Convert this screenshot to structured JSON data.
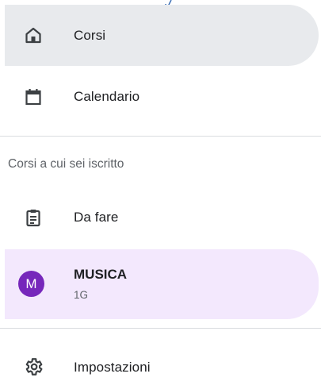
{
  "nav": {
    "items": [
      {
        "label": "Corsi",
        "icon": "home-icon",
        "state": "active"
      },
      {
        "label": "Calendario",
        "icon": "calendar-icon",
        "state": "normal"
      }
    ],
    "section_heading": "Corsi a cui sei iscritto",
    "todo": {
      "label": "Da fare",
      "icon": "clipboard-icon"
    },
    "course": {
      "avatar_letter": "M",
      "name": "MUSICA",
      "section": "1G",
      "avatar_color": "#7627bb",
      "highlight_color": "#f3e8fd"
    },
    "settings": {
      "label": "Impostazioni",
      "icon": "gear-icon"
    }
  },
  "colors": {
    "active_bg": "#e8eaed",
    "divider": "#dadce0",
    "icon": "#3c4043",
    "annotation_arrow": "#3b6fb6"
  }
}
